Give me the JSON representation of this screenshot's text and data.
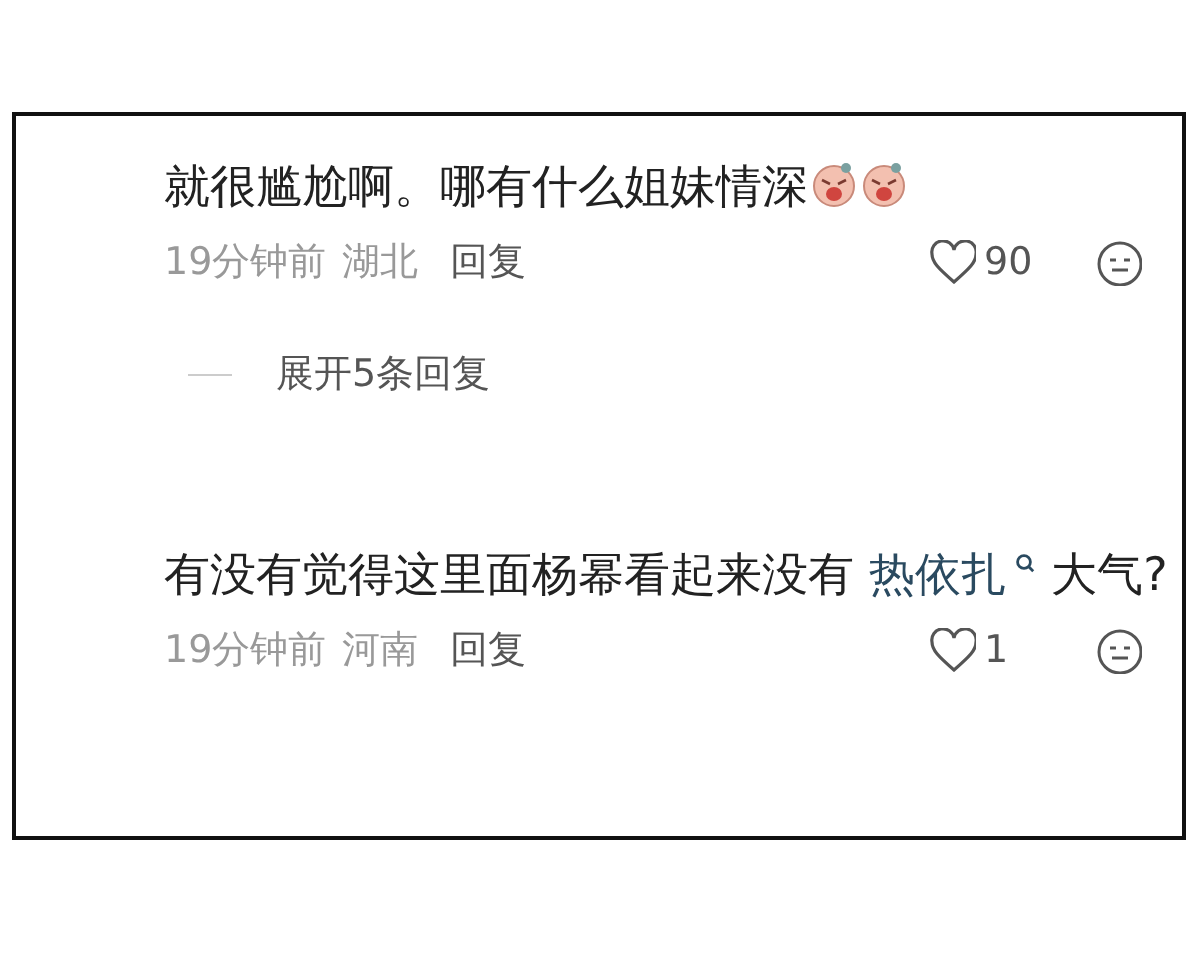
{
  "comments": [
    {
      "segments": [
        {
          "kind": "text",
          "text": "就很尴尬啊。哪有什么姐妹情深"
        },
        {
          "kind": "sticker"
        },
        {
          "kind": "sticker"
        }
      ],
      "time": "19分钟前",
      "region": "湖北",
      "reply": "回复",
      "likes": "90",
      "expand": "展开5条回复"
    },
    {
      "segments": [
        {
          "kind": "text",
          "text": "有没有觉得这里面杨幂看起来没有 "
        },
        {
          "kind": "link",
          "text": "热依扎"
        },
        {
          "kind": "text",
          "text": " 大气?"
        }
      ],
      "time": "19分钟前",
      "region": "河南",
      "reply": "回复",
      "likes": "1"
    }
  ]
}
